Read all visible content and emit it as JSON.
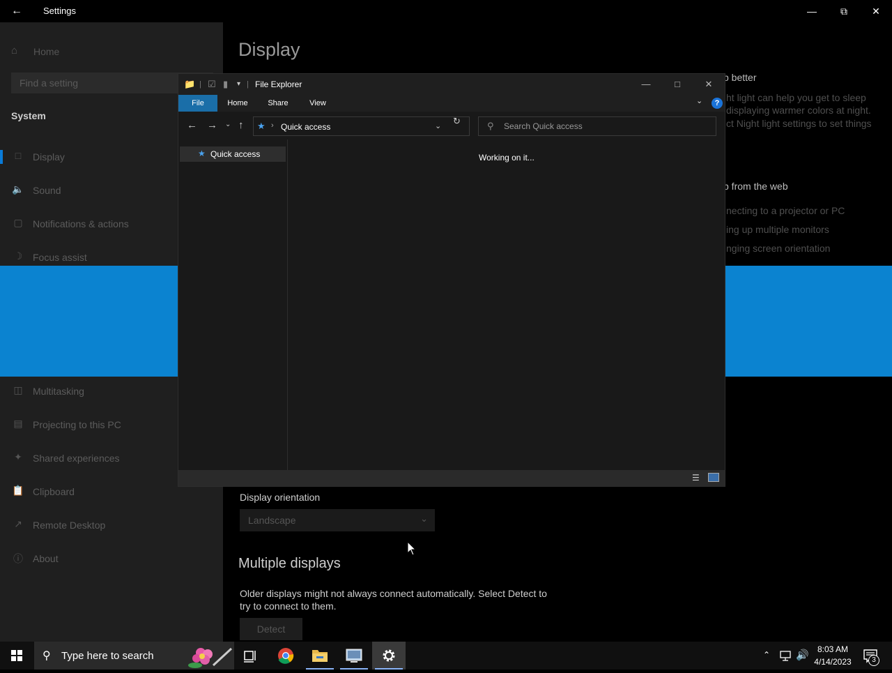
{
  "settings": {
    "title": "Settings",
    "back_icon": "back-arrow-icon",
    "nav": {
      "home": "Home",
      "search_placeholder": "Find a setting",
      "section": "System",
      "items": [
        {
          "label": "Display",
          "icon": "monitor-icon"
        },
        {
          "label": "Sound",
          "icon": "speaker-icon"
        },
        {
          "label": "Notifications & actions",
          "icon": "notification-icon"
        },
        {
          "label": "Focus assist",
          "icon": "moon-icon"
        },
        {
          "label": "Multitasking",
          "icon": "multitasking-icon"
        },
        {
          "label": "Projecting to this PC",
          "icon": "projecting-icon"
        },
        {
          "label": "Shared experiences",
          "icon": "shared-experiences-icon"
        },
        {
          "label": "Clipboard",
          "icon": "clipboard-icon"
        },
        {
          "label": "Remote Desktop",
          "icon": "remote-desktop-icon"
        },
        {
          "label": "About",
          "icon": "info-icon"
        }
      ]
    },
    "content": {
      "heading": "Display",
      "sidebar": {
        "night_light_heading": "p better",
        "night_light_lines": [
          "ht light can help you get to sleep",
          "displaying warmer colors at night.",
          "ct Night light settings to set things"
        ],
        "help_heading": "p from the web",
        "help_links": [
          "necting to a projector or PC",
          "ing up multiple monitors",
          "nging screen orientation"
        ]
      },
      "orientation_label": "Display orientation",
      "orientation_value": "Landscape",
      "multi_heading": "Multiple displays",
      "multi_desc": "Older displays might not always connect automatically. Select Detect to try to connect to them.",
      "detect_label": "Detect"
    }
  },
  "explorer": {
    "title": "File Explorer",
    "tabs": [
      "File",
      "Home",
      "Share",
      "View"
    ],
    "address": "Quick access",
    "search_placeholder": "Search Quick access",
    "pane_item": "Quick access",
    "status_message": "Working on it..."
  },
  "taskbar": {
    "search_text": "Type here to search",
    "time": "8:03 AM",
    "date": "4/14/2023",
    "notification_count": "3"
  },
  "colors": {
    "accent": "#0b83d0",
    "file_tab": "#1a6ea8",
    "nav_indicator": "#0a7bd8"
  }
}
